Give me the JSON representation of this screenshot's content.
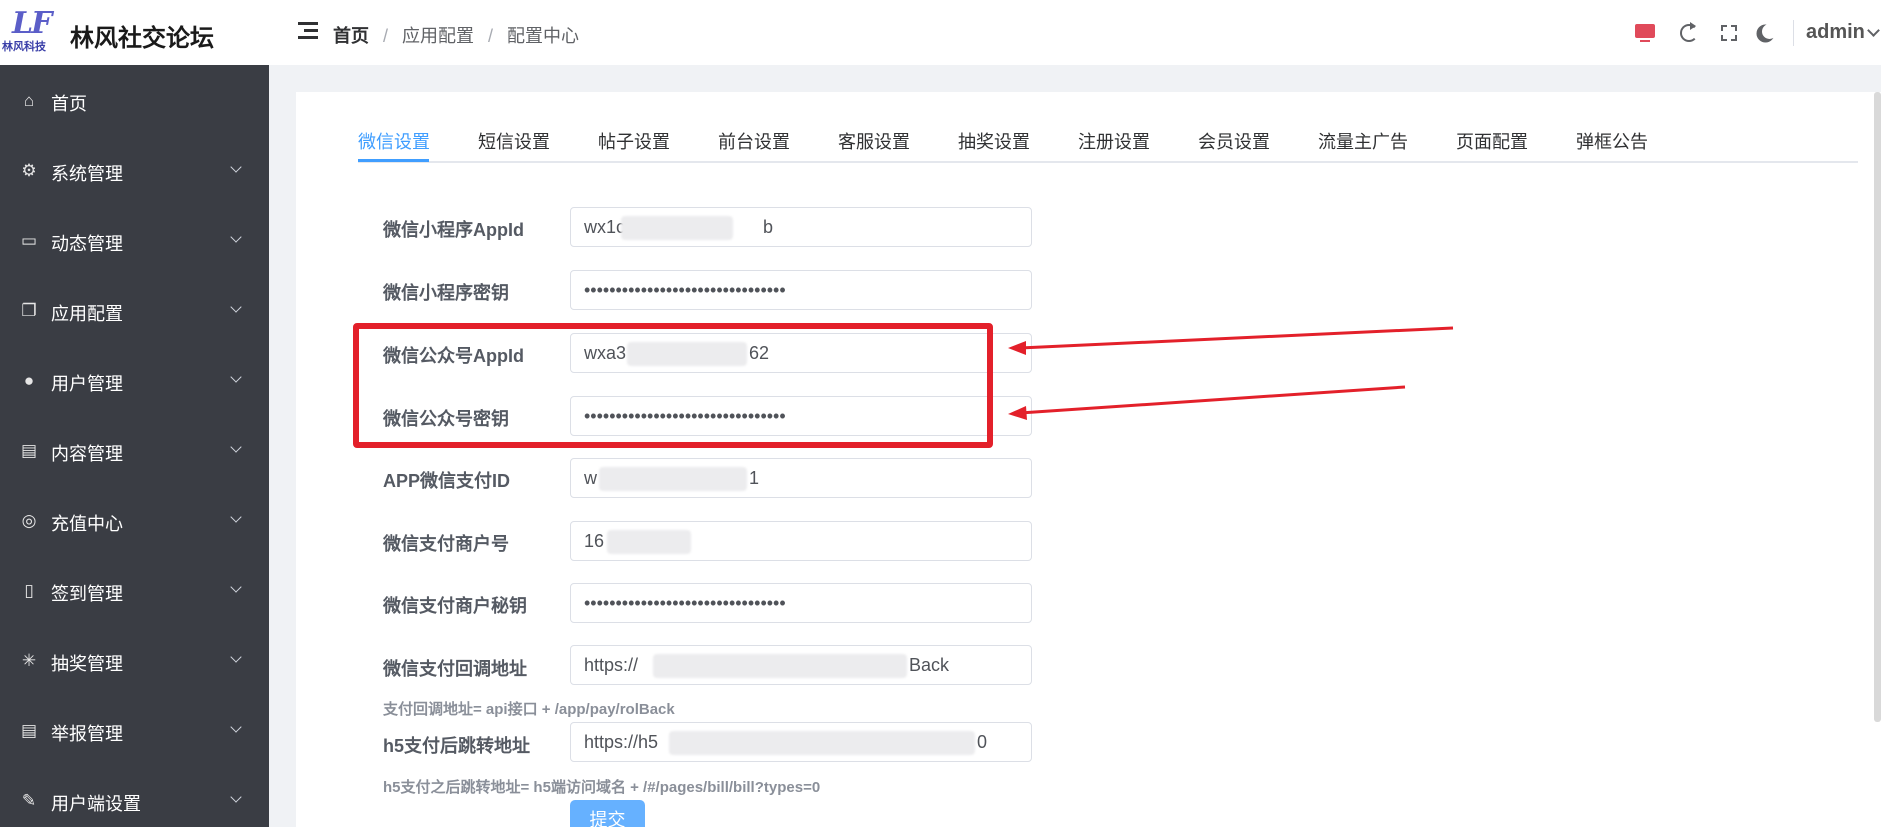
{
  "header": {
    "logo_text": "LF",
    "logo_sub": "林风科技",
    "site_title": "林风社交论坛",
    "breadcrumb": [
      "首页",
      "应用配置",
      "配置中心"
    ],
    "username": "admin"
  },
  "sidebar": {
    "items": [
      {
        "label": "首页",
        "icon": "home-icon",
        "glyph": "⌂",
        "expandable": false
      },
      {
        "label": "系统管理",
        "icon": "gear-icon",
        "glyph": "⚙",
        "expandable": true
      },
      {
        "label": "动态管理",
        "icon": "chat-icon",
        "glyph": "▭",
        "expandable": true
      },
      {
        "label": "应用配置",
        "icon": "copy-icon",
        "glyph": "❐",
        "expandable": true
      },
      {
        "label": "用户管理",
        "icon": "user-icon",
        "glyph": "●",
        "expandable": true
      },
      {
        "label": "内容管理",
        "icon": "card-icon",
        "glyph": "▤",
        "expandable": true
      },
      {
        "label": "充值中心",
        "icon": "coins-icon",
        "glyph": "◎",
        "expandable": true
      },
      {
        "label": "签到管理",
        "icon": "tablet-icon",
        "glyph": "▯",
        "expandable": true
      },
      {
        "label": "抽奖管理",
        "icon": "sparkle-icon",
        "glyph": "✳",
        "expandable": true
      },
      {
        "label": "举报管理",
        "icon": "report-icon",
        "glyph": "▤",
        "expandable": true
      },
      {
        "label": "用户端设置",
        "icon": "edit-icon",
        "glyph": "✎",
        "expandable": true
      }
    ]
  },
  "tabs": [
    "微信设置",
    "短信设置",
    "帖子设置",
    "前台设置",
    "客服设置",
    "抽奖设置",
    "注册设置",
    "会员设置",
    "流量主广告",
    "页面配置",
    "弹框公告"
  ],
  "active_tab": "微信设置",
  "form": {
    "fields": [
      {
        "label": "微信小程序AppId",
        "value": "wx1c",
        "tail": "b"
      },
      {
        "label": "微信小程序密钥",
        "value": "••••••••••••••••••••••••••••••••",
        "tail": ""
      },
      {
        "label": "微信公众号AppId",
        "value": "wxa3",
        "tail": "62"
      },
      {
        "label": "微信公众号密钥",
        "value": "••••••••••••••••••••••••••••••••",
        "tail": ""
      },
      {
        "label": "APP微信支付ID",
        "value": "w",
        "tail": "1"
      },
      {
        "label": "微信支付商户号",
        "value": "16",
        "tail": ""
      },
      {
        "label": "微信支付商户秘钥",
        "value": "••••••••••••••••••••••••••••••••",
        "tail": ""
      },
      {
        "label": "微信支付回调地址",
        "value": "https://",
        "tail": "Back"
      },
      {
        "label": "h5支付后跳转地址",
        "value": "https://h5",
        "tail": "0"
      }
    ],
    "hint_callback": "支付回调地址= api接口 + /app/pay/rolBack",
    "hint_h5": "h5支付之后跳转地址= h5端访问域名 + /#/pages/bill/bill?types=0",
    "submit_label": "提交"
  },
  "colors": {
    "accent": "#409eff",
    "sidebar_bg": "#3a3d44",
    "annotation_red": "#e3202a"
  }
}
